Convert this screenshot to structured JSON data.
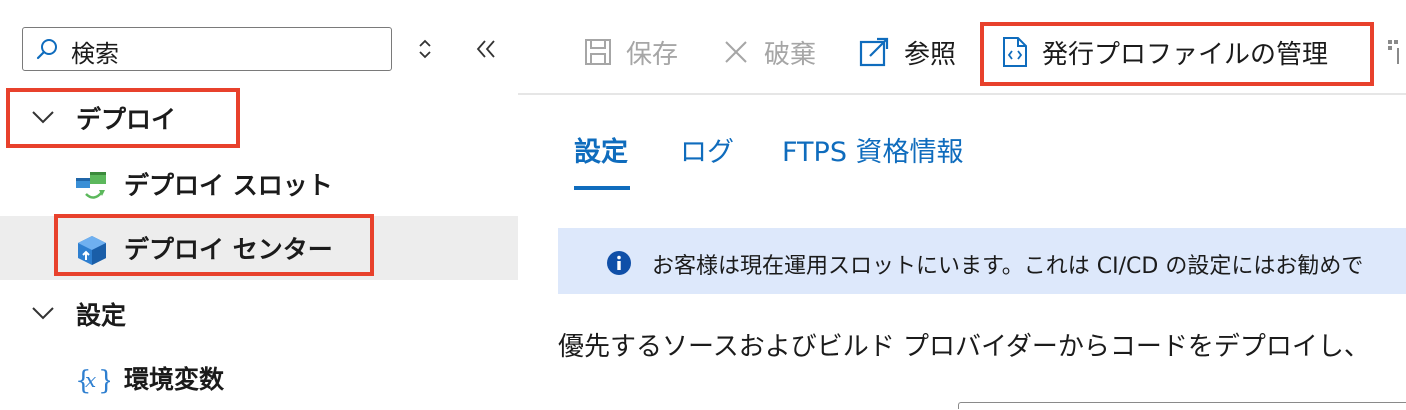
{
  "sidebar": {
    "search": {
      "placeholder": "検索"
    },
    "groups": [
      {
        "label": "デプロイ",
        "items": [
          {
            "label": "デプロイ スロット",
            "icon": "deployment-slots-icon"
          },
          {
            "label": "デプロイ センター",
            "icon": "deployment-center-icon",
            "selected": true
          }
        ]
      },
      {
        "label": "設定",
        "items": [
          {
            "label": "環境変数",
            "icon": "variable-icon"
          }
        ]
      }
    ]
  },
  "toolbar": {
    "save_label": "保存",
    "discard_label": "破棄",
    "browse_label": "参照",
    "manage_profile_label": "発行プロファイルの管理"
  },
  "tabs": [
    {
      "label": "設定",
      "active": true
    },
    {
      "label": "ログ"
    },
    {
      "label": "FTPS 資格情報"
    }
  ],
  "banner": {
    "text": "お客様は現在運用スロットにいます。これは CI/CD の設定にはお勧めで"
  },
  "description": "優先するソースおよびビルド プロバイダーからコードをデプロイし、",
  "colors": {
    "accent": "#0f6cbd",
    "highlight": "#e8412c",
    "banner_bg": "#dde8fb",
    "selected_bg": "#ededed"
  }
}
